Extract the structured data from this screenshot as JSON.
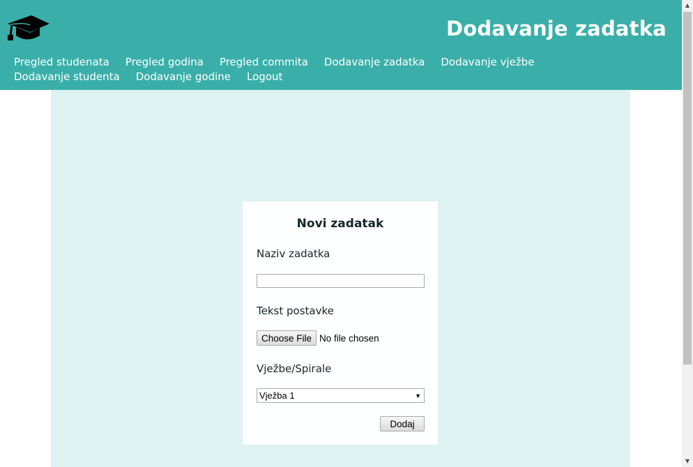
{
  "header": {
    "title": "Dodavanje zadatka",
    "logo_icon": "graduation-cap-icon",
    "background": "#3aafa9"
  },
  "nav": {
    "items": [
      {
        "label": "Pregled studenata"
      },
      {
        "label": "Pregled godina"
      },
      {
        "label": "Pregled commita"
      },
      {
        "label": "Dodavanje zadatka"
      },
      {
        "label": "Dodavanje vježbe"
      },
      {
        "label": "Dodavanje studenta"
      },
      {
        "label": "Dodavanje godine"
      },
      {
        "label": "Logout"
      }
    ]
  },
  "form": {
    "title": "Novi zadatak",
    "name_label": "Naziv zadatka",
    "name_value": "",
    "file_label": "Tekst postavke",
    "file_button": "Choose File",
    "file_status": "No file chosen",
    "select_label": "Vježbe/Spirale",
    "select_value": "Vježba 1",
    "submit_label": "Dodaj"
  },
  "colors": {
    "accent": "#3aafa9",
    "content_background": "#def2f1",
    "card_background": "#feffff",
    "text_dark": "#17252a"
  }
}
